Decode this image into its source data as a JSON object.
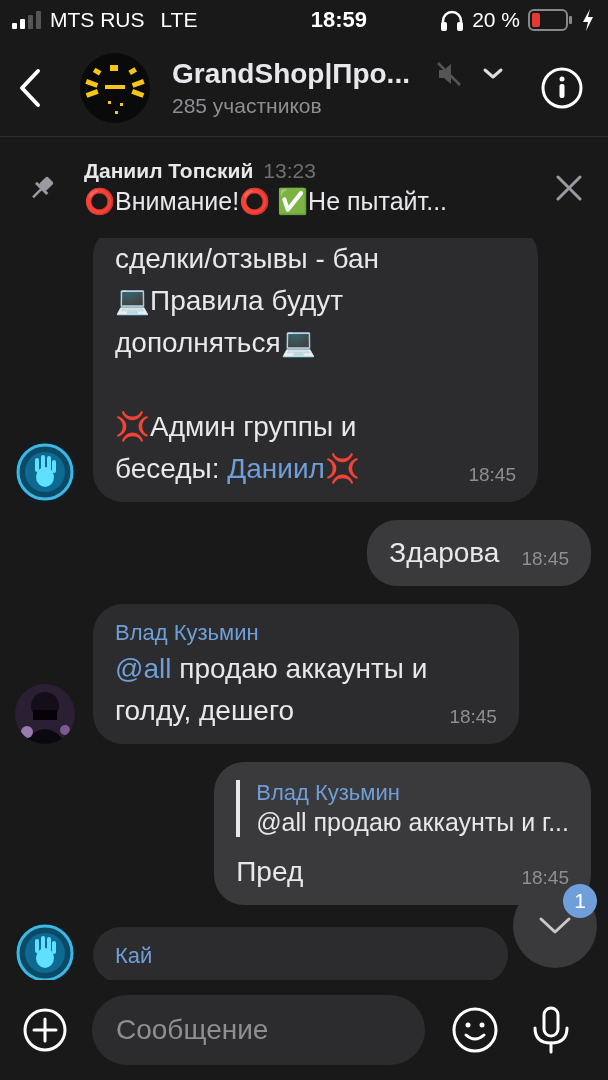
{
  "status_bar": {
    "carrier": "MTS RUS",
    "network": "LTE",
    "time": "18:59",
    "battery": "20 %"
  },
  "header": {
    "title": "GrandShop|Про...",
    "subtitle": "285 участников",
    "muted": true
  },
  "pinned": {
    "author": "Даниил Топский",
    "time": "13:23",
    "text": "⭕Внимание!⭕ ✅Не пытайт..."
  },
  "messages": [
    {
      "kind": "incoming",
      "parts": [
        {
          "kind": "text",
          "text": "сделки/отзывы - бан\n💻Правила будут\nдополняться💻\n\n💢Админ группы и\nбеседы: "
        },
        {
          "kind": "link",
          "text": "Даниил"
        },
        {
          "kind": "text",
          "text": "💢"
        }
      ],
      "time": "18:45"
    },
    {
      "kind": "outgoing",
      "parts": [
        {
          "kind": "text",
          "text": "Здарова"
        }
      ],
      "time": "18:45"
    },
    {
      "kind": "incoming",
      "author": "Влад Кузьмин",
      "parts": [
        {
          "kind": "link",
          "text": "@all"
        },
        {
          "kind": "text",
          "text": " продаю аккаунты и\nголду, дешего"
        }
      ],
      "time": "18:45"
    },
    {
      "kind": "outgoing",
      "reply": {
        "author": "Влад Кузьмин",
        "text": "@all продаю аккаунты и г..."
      },
      "parts": [
        {
          "kind": "text",
          "text": "Пред"
        }
      ],
      "time": "18:45"
    },
    {
      "kind": "incoming",
      "author": "Кай"
    }
  ],
  "scroll_button": {
    "badge": "1"
  },
  "composer": {
    "placeholder": "Сообщение"
  }
}
